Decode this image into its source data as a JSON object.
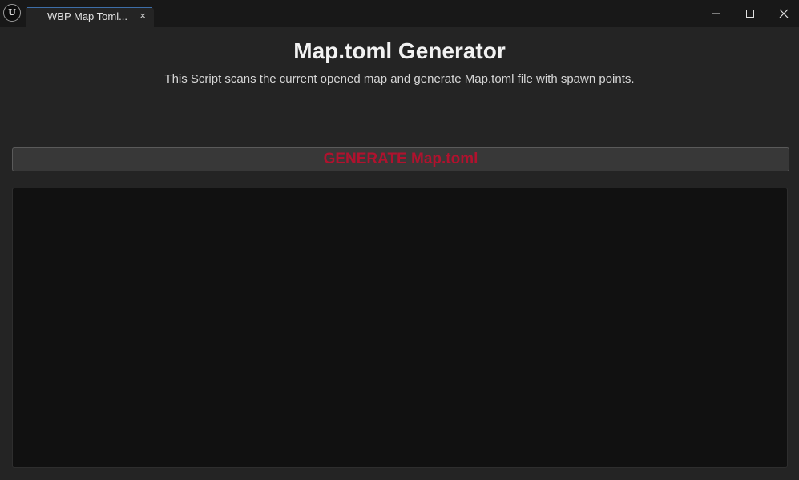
{
  "window": {
    "app_icon": "unreal-engine-logo-icon",
    "app_icon_glyph": "U",
    "tab_title": "WBP Map Toml...",
    "tab_close_glyph": "×",
    "minimize_icon": "minimize-icon",
    "maximize_icon": "maximize-icon",
    "close_icon": "close-icon"
  },
  "main": {
    "title": "Map.toml Generator",
    "subtitle": "This Script scans the current opened map and generate Map.toml file with spawn points.",
    "generate_button_label": "GENERATE Map.toml",
    "output_text": ""
  },
  "colors": {
    "background": "#242424",
    "titlebar": "#181818",
    "button_label": "#b0122e",
    "output_panel": "#111111"
  }
}
